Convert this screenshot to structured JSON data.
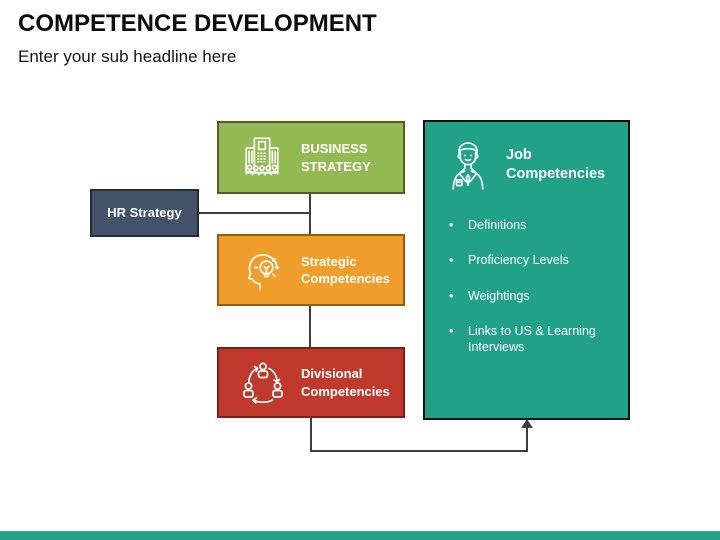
{
  "slide": {
    "title": "COMPETENCE DEVELOPMENT",
    "subtitle": "Enter your sub headline here"
  },
  "diagram": {
    "business": {
      "label": "BUSINESS STRATEGY",
      "icon": "building-people-icon",
      "fill": "#93B952",
      "border": "#4C611F"
    },
    "hr": {
      "label": "HR Strategy",
      "fill": "#44526A",
      "border": "#232C3C"
    },
    "strategic": {
      "label": "Strategic Competencies",
      "icon": "head-lightbulb-icon",
      "fill": "#F09D2C",
      "border": "#935E07"
    },
    "divisional": {
      "label": "Divisional Competencies",
      "icon": "people-cycle-icon",
      "fill": "#BF3A2D",
      "border": "#74221B"
    },
    "job": {
      "label": "Job Competencies",
      "icon": "businessman-icon",
      "fill": "#21A288",
      "border": "#111111",
      "bullets": [
        "Definitions",
        "Proficiency Levels",
        "Weightings",
        "Links to US & Learning Interviews"
      ]
    },
    "connector_color": "#3F3F3F"
  },
  "footer": {
    "bar_color": "#21A38B"
  }
}
